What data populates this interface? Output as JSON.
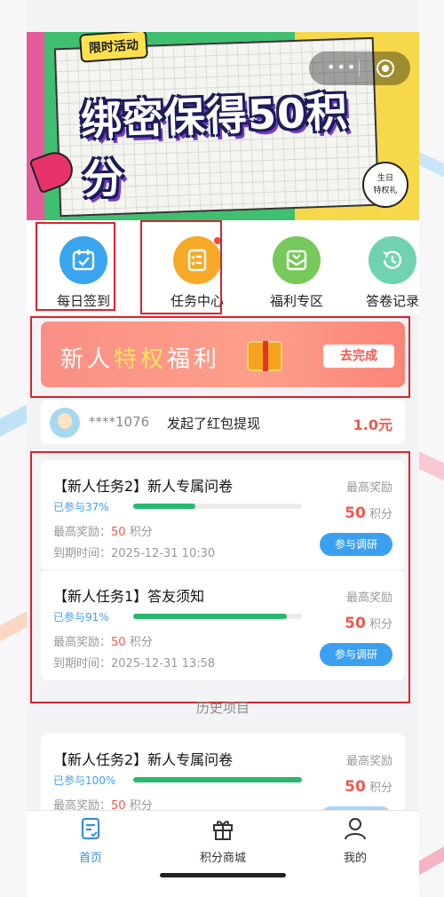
{
  "banner": {
    "tag": "限时活动",
    "headline": "绑密保得50积分",
    "birthday_line1": "生日",
    "birthday_line2": "特权礼"
  },
  "quick_menu": [
    {
      "label": "每日签到",
      "icon": "calendar-check-icon",
      "color": "#3aa4ef"
    },
    {
      "label": "任务中心",
      "icon": "task-list-icon",
      "color": "#f7a928",
      "badge": true
    },
    {
      "label": "福利专区",
      "icon": "gift-box-icon",
      "color": "#76c95a"
    },
    {
      "label": "答卷记录",
      "icon": "history-icon",
      "color": "#6fd3b0"
    }
  ],
  "privilege": {
    "text_a": "新人",
    "text_highlight": "特权",
    "text_b": "福利",
    "button": "去完成"
  },
  "ticker": {
    "user": "****1076",
    "action": "发起了红包提现",
    "amount": "1.0元"
  },
  "tasks": [
    {
      "title": "【新人任务2】新人专属问卷",
      "progress_text": "已参与37%",
      "progress": 0.37,
      "reward_label": "最高奖励：",
      "reward_value": "50",
      "reward_unit": "积分",
      "due": "到期时间：2025-12-31 10:30",
      "right_label": "最高奖励",
      "right_value": "50",
      "right_unit": "积分",
      "button": "参与调研"
    },
    {
      "title": "【新人任务1】答友须知",
      "progress_text": "已参与91%",
      "progress": 0.91,
      "reward_label": "最高奖励：",
      "reward_value": "50",
      "reward_unit": "积分",
      "due": "到期时间：2025-12-31 13:58",
      "right_label": "最高奖励",
      "right_value": "50",
      "right_unit": "积分",
      "button": "参与调研"
    }
  ],
  "history_title": "历史项目",
  "history_task": {
    "title": "【新人任务2】新人专属问卷",
    "progress_text": "已参与100%",
    "progress": 1.0,
    "reward_label": "最高奖励：",
    "reward_value": "50",
    "reward_unit": "积分",
    "right_label": "最高奖励",
    "right_value": "50",
    "right_unit": "积分"
  },
  "nav": [
    {
      "label": "首页",
      "icon": "home-doc-icon",
      "active": true
    },
    {
      "label": "积分商城",
      "icon": "gift-icon",
      "active": false
    },
    {
      "label": "我的",
      "icon": "user-icon",
      "active": false
    }
  ],
  "colors": {
    "accent_blue": "#3ba0f0",
    "reward_red": "#f0584e",
    "progress_green": "#27b86f",
    "highlight_box": "#d9232d"
  }
}
